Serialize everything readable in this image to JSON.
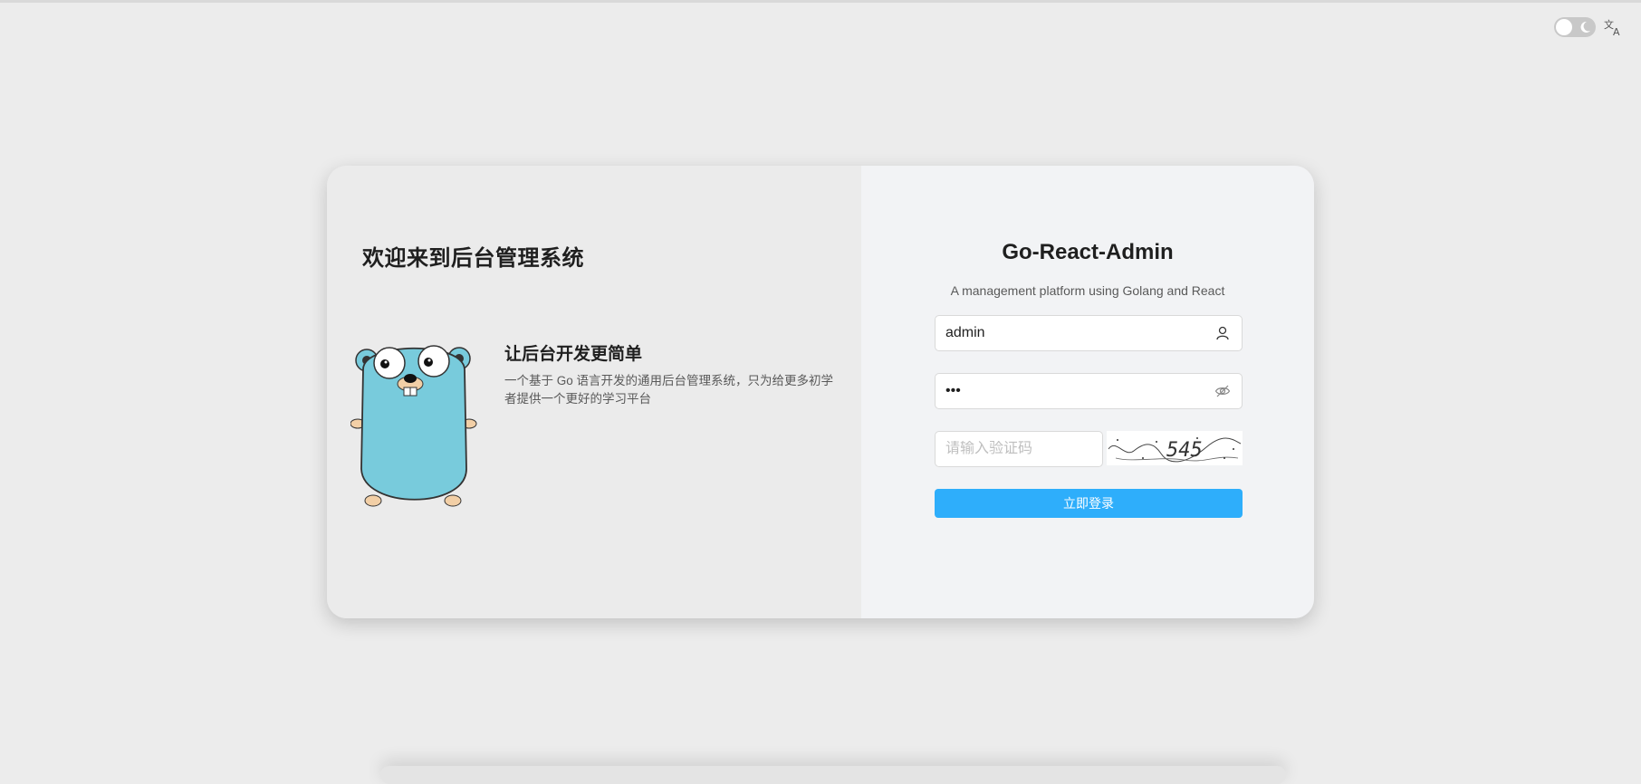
{
  "top_controls": {
    "theme_toggle_icon": "moon-icon",
    "language_icon": "translate-icon"
  },
  "left_panel": {
    "welcome_title": "欢迎来到后台管理系统",
    "slogan": "让后台开发更简单",
    "slogan_desc": "一个基于 Go 语言开发的通用后台管理系统，只为给更多初学者提供一个更好的学习平台",
    "illustration": "gopher-mascot"
  },
  "login_form": {
    "title": "Go-React-Admin",
    "subtitle": "A management platform using Golang and React",
    "username_value": "admin",
    "password_value": "123",
    "captcha_placeholder": "请输入验证码",
    "captcha_text": "545",
    "submit_label": "立即登录"
  },
  "colors": {
    "primary": "#2eaefb",
    "gopher_body": "#78cbdc"
  }
}
